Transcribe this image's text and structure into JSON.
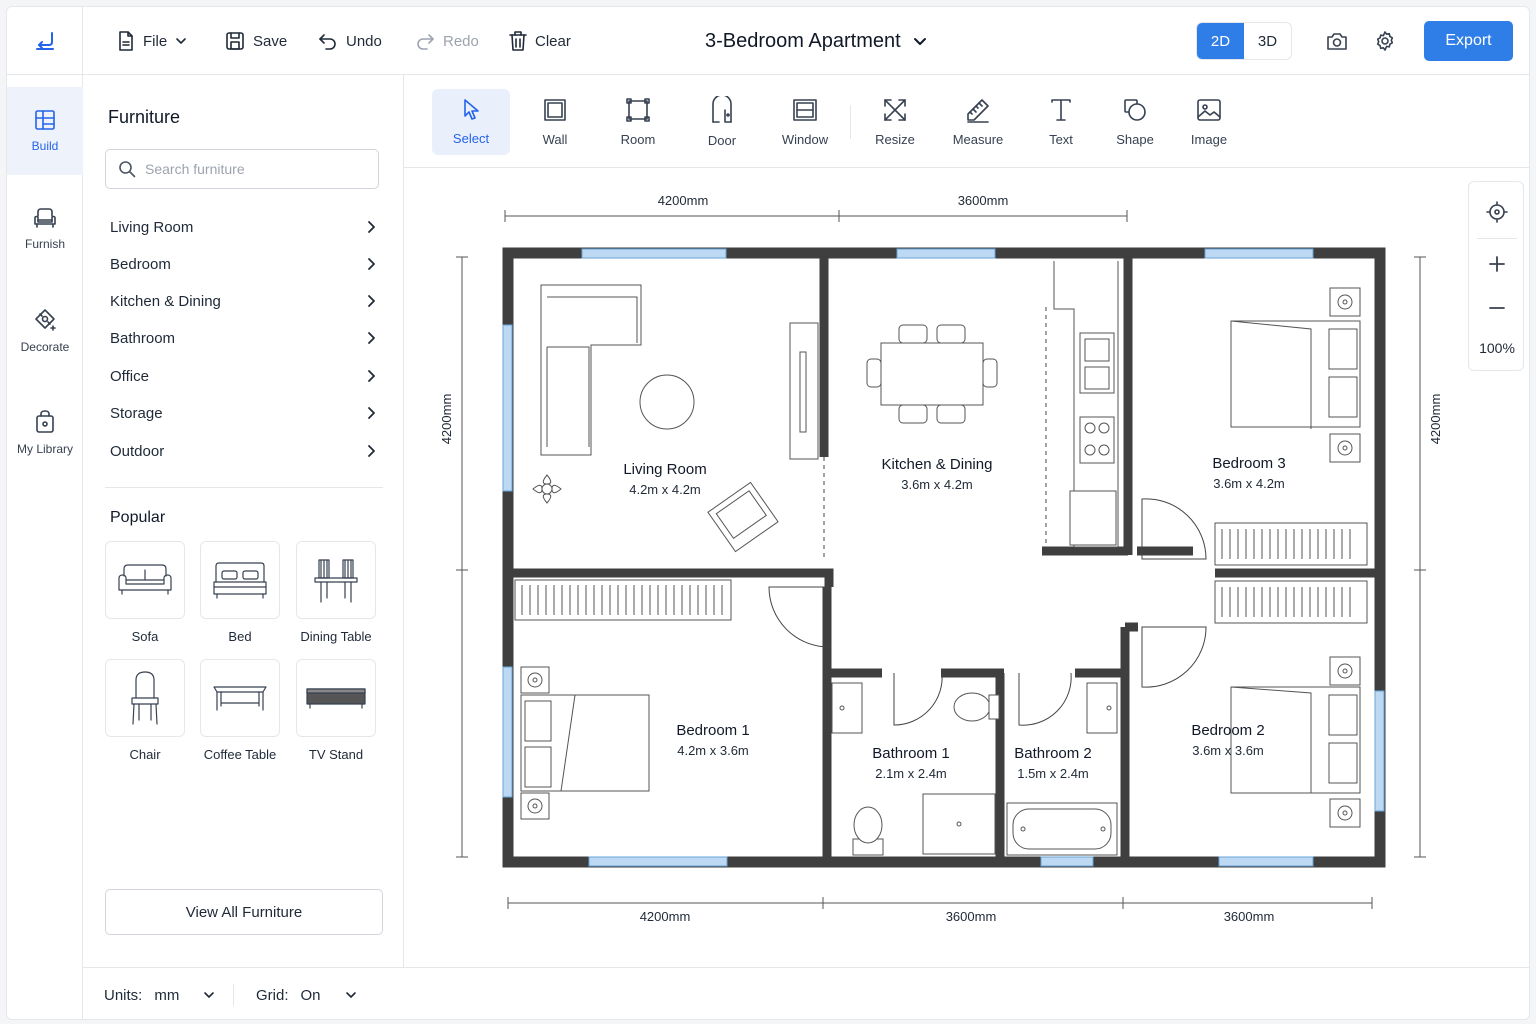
{
  "topbar": {
    "file_label": "File",
    "save_label": "Save",
    "undo_label": "Undo",
    "redo_label": "Redo",
    "clear_label": "Clear",
    "document_title": "3-Bedroom Apartment",
    "view_2d": "2D",
    "view_3d": "3D",
    "active_view": "2D",
    "export_label": "Export"
  },
  "leftnav": {
    "items": [
      {
        "label": "Build",
        "icon": "layout-grid-icon",
        "active": true
      },
      {
        "label": "Furnish",
        "icon": "armchair-icon",
        "active": false
      },
      {
        "label": "Decorate",
        "icon": "decorate-icon",
        "active": false
      },
      {
        "label": "My Library",
        "icon": "library-bag-icon",
        "active": false
      }
    ]
  },
  "furniture": {
    "title": "Furniture",
    "search_placeholder": "Search furniture",
    "categories": [
      "Living Room",
      "Bedroom",
      "Kitchen & Dining",
      "Bathroom",
      "Office",
      "Storage",
      "Outdoor"
    ],
    "popular_title": "Popular",
    "popular": [
      {
        "label": "Sofa",
        "icon": "sofa-icon"
      },
      {
        "label": "Bed",
        "icon": "bed-icon"
      },
      {
        "label": "Dining Table",
        "icon": "dining-table-icon"
      },
      {
        "label": "Chair",
        "icon": "chair-icon"
      },
      {
        "label": "Coffee Table",
        "icon": "coffee-table-icon"
      },
      {
        "label": "TV Stand",
        "icon": "tv-stand-icon"
      }
    ],
    "view_all_label": "View All Furniture"
  },
  "tools": {
    "items": [
      {
        "label": "Select",
        "icon": "cursor-icon",
        "active": true
      },
      {
        "label": "Wall",
        "icon": "wall-icon",
        "active": false
      },
      {
        "label": "Room",
        "icon": "room-icon",
        "active": false
      },
      {
        "label": "Door",
        "icon": "door-icon",
        "active": false
      },
      {
        "label": "Window",
        "icon": "window-icon",
        "active": false
      },
      {
        "label": "Resize",
        "icon": "resize-icon",
        "active": false
      },
      {
        "label": "Measure",
        "icon": "ruler-icon",
        "active": false
      },
      {
        "label": "Text",
        "icon": "text-icon",
        "active": false
      },
      {
        "label": "Shape",
        "icon": "shape-icon",
        "active": false
      },
      {
        "label": "Image",
        "icon": "image-icon",
        "active": false
      }
    ]
  },
  "zoom": {
    "level": "100%"
  },
  "statusbar": {
    "units_label": "Units:",
    "units_value": "mm",
    "grid_label": "Grid:",
    "grid_value": "On"
  },
  "floorplan": {
    "rooms": [
      {
        "name": "Living Room",
        "size": "4.2m x 4.2m"
      },
      {
        "name": "Kitchen & Dining",
        "size": "3.6m x 4.2m"
      },
      {
        "name": "Bedroom 3",
        "size": "3.6m x 4.2m"
      },
      {
        "name": "Bedroom 1",
        "size": "4.2m x 3.6m"
      },
      {
        "name": "Bathroom 1",
        "size": "2.1m x 2.4m"
      },
      {
        "name": "Bathroom 2",
        "size": "1.5m x 2.4m"
      },
      {
        "name": "Bedroom 2",
        "size": "3.6m x 3.6m"
      }
    ],
    "dimensions": {
      "top": [
        "4200mm",
        "3600mm"
      ],
      "bottom": [
        "4200mm",
        "3600mm",
        "3600mm"
      ],
      "left": "4200mm",
      "right": "4200mm"
    },
    "colors": {
      "wall": "#3f3f3f",
      "window": "#9cc5ea",
      "accent": "#2f7ee8"
    }
  }
}
